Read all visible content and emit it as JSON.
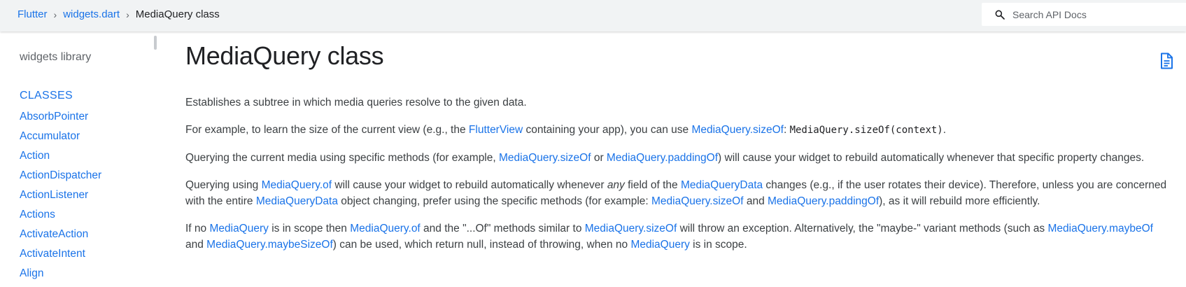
{
  "breadcrumb": {
    "items": [
      "Flutter",
      "widgets.dart"
    ],
    "current": "MediaQuery class",
    "separator": "›"
  },
  "search": {
    "placeholder": "Search API Docs"
  },
  "sidebar": {
    "library": "widgets library",
    "section": "CLASSES",
    "items": [
      "AbsorbPointer",
      "Accumulator",
      "Action",
      "ActionDispatcher",
      "ActionListener",
      "Actions",
      "ActivateAction",
      "ActivateIntent",
      "Align"
    ]
  },
  "main": {
    "title": "MediaQuery class",
    "p1": "Establishes a subtree in which media queries resolve to the given data.",
    "p2": {
      "t1": "For example, to learn the size of the current view (e.g., the ",
      "l1": "FlutterView",
      "t2": " containing your app), you can use ",
      "l2": "MediaQuery.sizeOf",
      "t3": ": ",
      "code": "MediaQuery.sizeOf(context)",
      "t4": "."
    },
    "p3": {
      "t1": "Querying the current media using specific methods (for example, ",
      "l1": "MediaQuery.sizeOf",
      "t2": " or ",
      "l2": "MediaQuery.paddingOf",
      "t3": ") will cause your widget to rebuild automatically whenever that specific property changes."
    },
    "p4": {
      "t1": "Querying using ",
      "l1": "MediaQuery.of",
      "t2": " will cause your widget to rebuild automatically whenever ",
      "em": "any",
      "t3": " field of the ",
      "l2": "MediaQueryData",
      "t4": " changes (e.g., if the user rotates their device). Therefore, unless you are concerned with the entire ",
      "l3": "MediaQueryData",
      "t5": " object changing, prefer using the specific methods (for example: ",
      "l4": "MediaQuery.sizeOf",
      "t6": " and ",
      "l5": "MediaQuery.paddingOf",
      "t7": "), as it will rebuild more efficiently."
    },
    "p5": {
      "t1": "If no ",
      "l1": "MediaQuery",
      "t2": " is in scope then ",
      "l2": "MediaQuery.of",
      "t3": " and the \"...Of\" methods similar to ",
      "l3": "MediaQuery.sizeOf",
      "t4": " will throw an exception. Alternatively, the \"maybe-\" variant methods (such as ",
      "l4": "MediaQuery.maybeOf",
      "t5": " and ",
      "l5": "MediaQuery.maybeSizeOf",
      "t6": ") can be used, which return null, instead of throwing, when no ",
      "l6": "MediaQuery",
      "t7": " is in scope."
    }
  },
  "icons": {
    "search": "search-icon",
    "doc": "document-icon"
  },
  "colors": {
    "link": "#1a73e8",
    "topbar": "#f1f3f4",
    "text": "#3c4043"
  }
}
